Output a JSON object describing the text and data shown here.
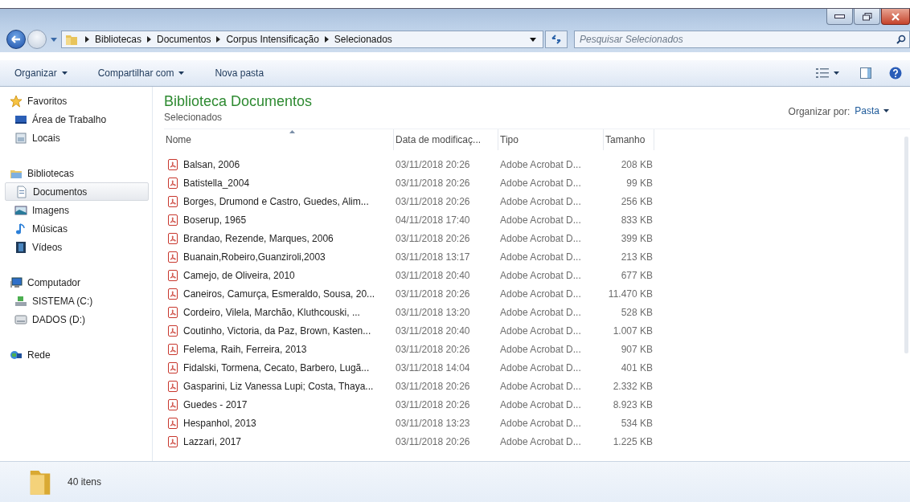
{
  "address_bar": {
    "breadcrumbs": [
      "Bibliotecas",
      "Documentos",
      "Corpus Intensificação",
      "Selecionados"
    ]
  },
  "search": {
    "placeholder": "Pesquisar Selecionados"
  },
  "toolbar": {
    "buttons": [
      {
        "label": "Organizar",
        "dropdown": true
      },
      {
        "label": "Compartilhar com",
        "dropdown": true
      },
      {
        "label": "Nova pasta",
        "dropdown": false
      }
    ]
  },
  "sidebar": {
    "groups": [
      {
        "label": "Favoritos",
        "selected": false,
        "children": [
          {
            "label": "Área de Trabalho",
            "selected": false
          },
          {
            "label": "Locais",
            "selected": false
          }
        ]
      },
      {
        "label": "Bibliotecas",
        "selected": false,
        "children": [
          {
            "label": "Documentos",
            "selected": true
          },
          {
            "label": "Imagens",
            "selected": false
          },
          {
            "label": "Músicas",
            "selected": false
          },
          {
            "label": "Vídeos",
            "selected": false
          }
        ]
      },
      {
        "label": "Computador",
        "selected": false,
        "children": [
          {
            "label": "SISTEMA (C:)",
            "selected": false
          },
          {
            "label": "DADOS (D:)",
            "selected": false
          }
        ]
      },
      {
        "label": "Rede",
        "selected": false
      }
    ]
  },
  "library": {
    "title": "Biblioteca Documentos",
    "subtitle": "Selecionados",
    "arrange_label": "Organizar por:",
    "arrange_value": "Pasta"
  },
  "table": {
    "columns": [
      {
        "label": "Nome",
        "sorted": true
      },
      {
        "label": "Data de modificaç...",
        "sorted": false
      },
      {
        "label": "Tipo",
        "sorted": false
      },
      {
        "label": "Tamanho",
        "sorted": false
      }
    ],
    "rows": [
      [
        "Balsan, 2006",
        "03/11/2018 20:26",
        "Adobe Acrobat D...",
        "208 KB"
      ],
      [
        "Batistella_2004",
        "03/11/2018 20:26",
        "Adobe Acrobat D...",
        "99 KB"
      ],
      [
        "Borges, Drumond e Castro, Guedes, Alim...",
        "03/11/2018 20:26",
        "Adobe Acrobat D...",
        "256 KB"
      ],
      [
        "Boserup, 1965",
        "04/11/2018 17:40",
        "Adobe Acrobat D...",
        "833 KB"
      ],
      [
        "Brandao, Rezende, Marques, 2006",
        "03/11/2018 20:26",
        "Adobe Acrobat D...",
        "399 KB"
      ],
      [
        "Buanain,Robeiro,Guanziroli,2003",
        "03/11/2018 13:17",
        "Adobe Acrobat D...",
        "213 KB"
      ],
      [
        "Camejo, de Oliveira, 2010",
        "03/11/2018 20:40",
        "Adobe Acrobat D...",
        "677 KB"
      ],
      [
        "Caneiros, Camurça, Esmeraldo, Sousa, 20...",
        "03/11/2018 20:26",
        "Adobe Acrobat D...",
        "11.470 KB"
      ],
      [
        "Cordeiro, Vilela, Marchão, Kluthcouski, ...",
        "03/11/2018 13:20",
        "Adobe Acrobat D...",
        "528 KB"
      ],
      [
        "Coutinho, Victoria, da Paz, Brown, Kasten...",
        "03/11/2018 20:40",
        "Adobe Acrobat D...",
        "1.007 KB"
      ],
      [
        "Felema, Raih, Ferreira, 2013",
        "03/11/2018 20:26",
        "Adobe Acrobat D...",
        "907 KB"
      ],
      [
        "Fidalski, Tormena, Cecato, Barbero, Lugã...",
        "03/11/2018 14:04",
        "Adobe Acrobat D...",
        "401 KB"
      ],
      [
        "Gasparini, Liz Vanessa Lupi; Costa, Thaya...",
        "03/11/2018 20:26",
        "Adobe Acrobat D...",
        "2.332 KB"
      ],
      [
        "Guedes - 2017",
        "03/11/2018 20:26",
        "Adobe Acrobat D...",
        "8.923 KB"
      ],
      [
        "Hespanhol, 2013",
        "03/11/2018 13:23",
        "Adobe Acrobat D...",
        "534 KB"
      ],
      [
        "Lazzari, 2017",
        "03/11/2018 20:26",
        "Adobe Acrobat D...",
        "1.225 KB"
      ]
    ]
  },
  "status_bar": {
    "count": "40 itens"
  }
}
